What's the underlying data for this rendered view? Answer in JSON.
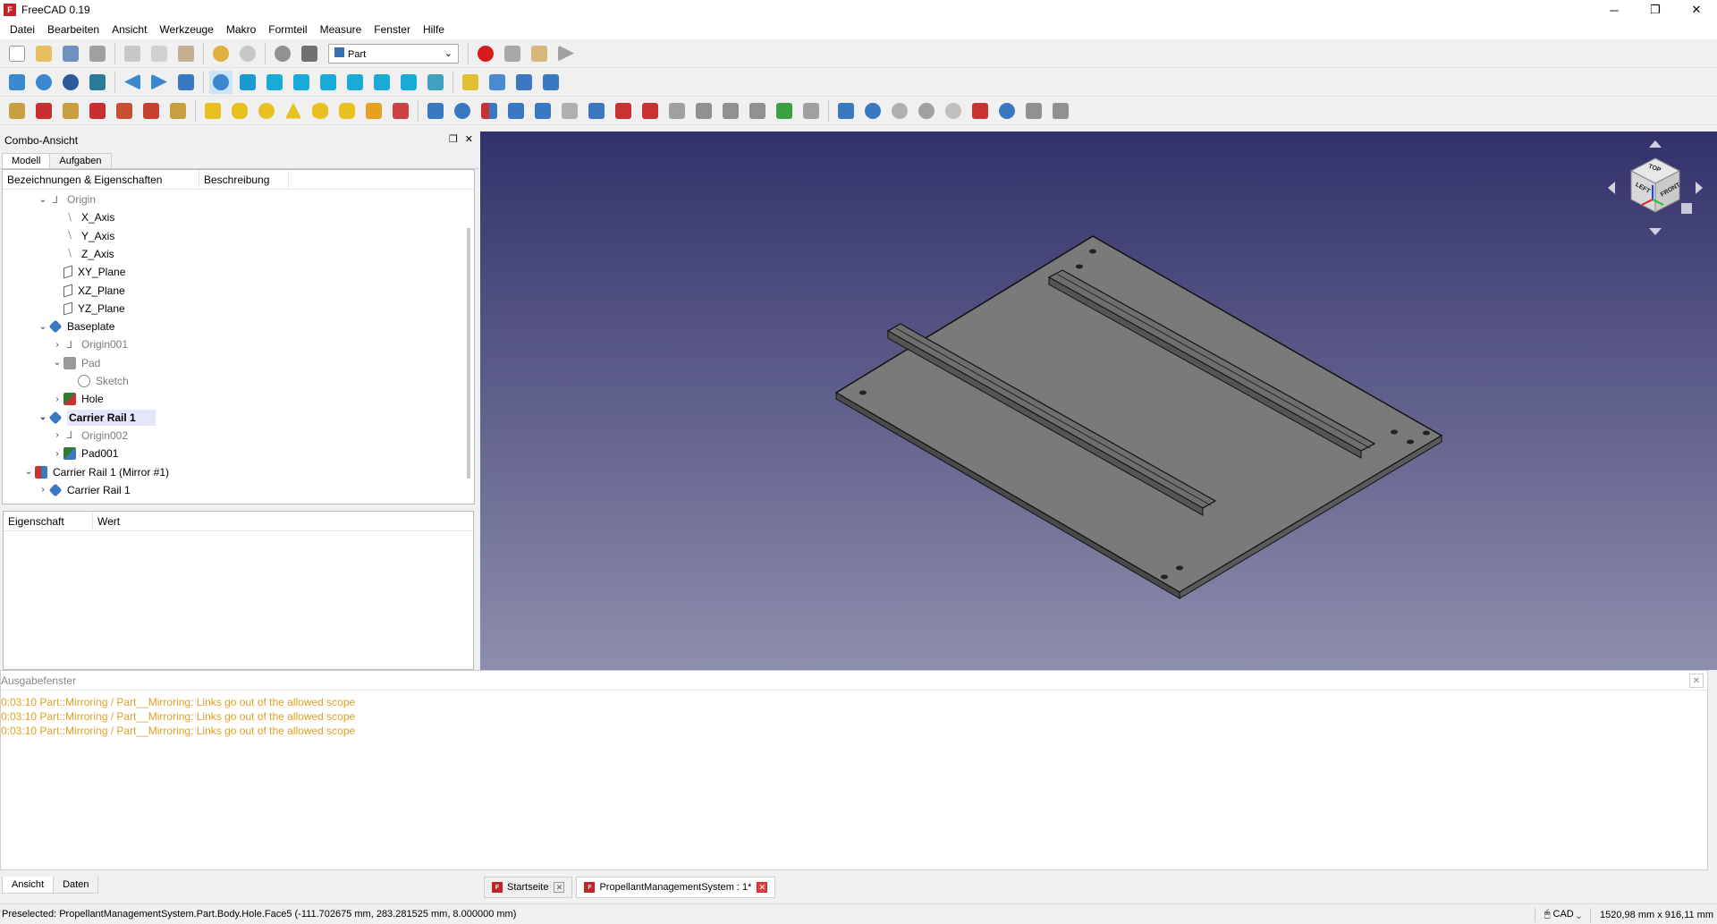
{
  "window": {
    "title": "FreeCAD 0.19",
    "minimize": "─",
    "maximize": "❐",
    "close": "✕"
  },
  "menu": [
    "Datei",
    "Bearbeiten",
    "Ansicht",
    "Werkzeuge",
    "Makro",
    "Formteil",
    "Measure",
    "Fenster",
    "Hilfe"
  ],
  "workbench": {
    "selected": "Part"
  },
  "combo": {
    "title": "Combo-Ansicht",
    "tabs": [
      "Modell",
      "Aufgaben"
    ],
    "tree_headers": [
      "Bezeichnungen & Eigenschaften",
      "Beschreibung"
    ],
    "tree": [
      {
        "label": "Origin",
        "depth": 2,
        "arrow": "⌄",
        "icon": "origin",
        "style": "gray"
      },
      {
        "label": "X_Axis",
        "depth": 3,
        "arrow": "",
        "icon": "axis",
        "style": ""
      },
      {
        "label": "Y_Axis",
        "depth": 3,
        "arrow": "",
        "icon": "axis",
        "style": ""
      },
      {
        "label": "Z_Axis",
        "depth": 3,
        "arrow": "",
        "icon": "axis",
        "style": ""
      },
      {
        "label": "XY_Plane",
        "depth": 3,
        "arrow": "",
        "icon": "plane",
        "style": ""
      },
      {
        "label": "XZ_Plane",
        "depth": 3,
        "arrow": "",
        "icon": "plane",
        "style": ""
      },
      {
        "label": "YZ_Plane",
        "depth": 3,
        "arrow": "",
        "icon": "plane",
        "style": ""
      },
      {
        "label": "Baseplate",
        "depth": 2,
        "arrow": "⌄",
        "icon": "body",
        "style": ""
      },
      {
        "label": "Origin001",
        "depth": 3,
        "arrow": "›",
        "icon": "origin",
        "style": "gray"
      },
      {
        "label": "Pad",
        "depth": 3,
        "arrow": "⌄",
        "icon": "pad",
        "style": "gray"
      },
      {
        "label": "Sketch",
        "depth": 4,
        "arrow": "",
        "icon": "sketch",
        "style": "gray"
      },
      {
        "label": "Hole",
        "depth": 3,
        "arrow": "›",
        "icon": "hole",
        "style": ""
      },
      {
        "label": "Carrier Rail 1",
        "depth": 2,
        "arrow": "⌄",
        "icon": "body",
        "style": "bold selected"
      },
      {
        "label": "Origin002",
        "depth": 3,
        "arrow": "›",
        "icon": "origin",
        "style": "gray"
      },
      {
        "label": "Pad001",
        "depth": 3,
        "arrow": "›",
        "icon": "padok",
        "style": ""
      },
      {
        "label": "Carrier Rail 1 (Mirror #1)",
        "depth": 1,
        "arrow": "⌄",
        "icon": "mirror",
        "style": ""
      },
      {
        "label": "Carrier Rail 1",
        "depth": 2,
        "arrow": "›",
        "icon": "body",
        "style": ""
      }
    ],
    "props_headers": [
      "Eigenschaft",
      "Wert"
    ]
  },
  "output": {
    "title": "Ausgabefenster",
    "lines": [
      "0:03:10  Part::Mirroring / Part__Mirroring: Links go out of the allowed scope",
      "0:03:10  Part::Mirroring / Part__Mirroring: Links go out of the allowed scope",
      "0:03:10  Part::Mirroring / Part__Mirroring: Links go out of the allowed scope"
    ]
  },
  "bottom_tabs": [
    "Ansicht",
    "Daten"
  ],
  "doc_tabs": [
    {
      "label": "Startseite",
      "active": false
    },
    {
      "label": "PropellantManagementSystem : 1*",
      "active": true
    }
  ],
  "status": {
    "preselected": "Preselected: PropellantManagementSystem.Part.Body.Hole.Face5 (-111.702675 mm, 283.281525 mm, 8.000000 mm)",
    "nav": "CAD",
    "dims": "1520,98 mm x 916,11 mm"
  },
  "navcube": {
    "top": "TOP",
    "left": "LEFT",
    "front": "FRONT"
  },
  "colors": {
    "viewport_top": "#32316b",
    "viewport_bottom": "#8d8ead",
    "record": "#d81c1c",
    "log": "#e0a020"
  }
}
